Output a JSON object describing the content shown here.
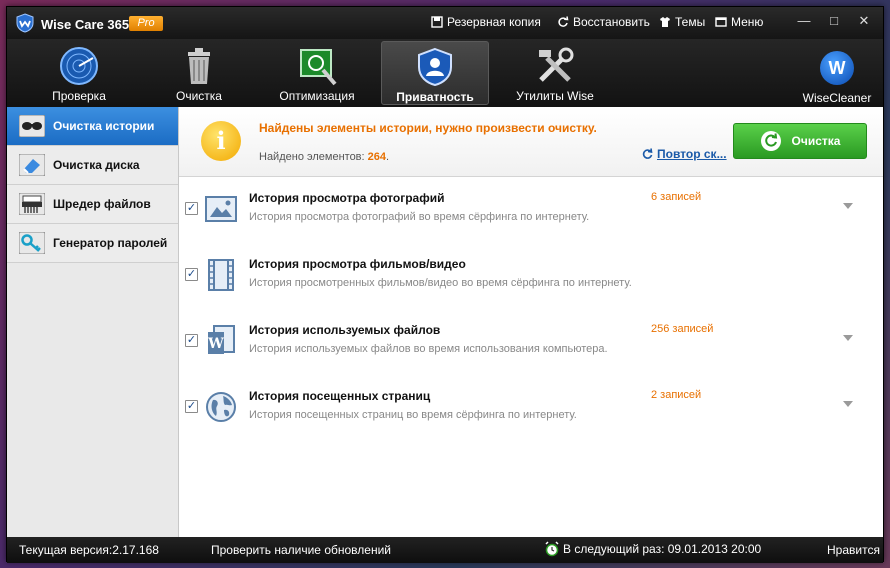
{
  "app": {
    "name": "Wise Care 365",
    "edition": "Pro"
  },
  "top_links": [
    {
      "label": "Резервная копия",
      "icon": "backup-icon"
    },
    {
      "label": "Восстановить",
      "icon": "restore-icon"
    },
    {
      "label": "Темы",
      "icon": "shirt-icon"
    },
    {
      "label": "Меню",
      "icon": "menu-icon"
    }
  ],
  "window_controls": {
    "minimize": "—",
    "maximize": "□",
    "close": "✕"
  },
  "toolbar": [
    {
      "label": "Проверка",
      "icon": "radar-icon"
    },
    {
      "label": "Очистка",
      "icon": "trash-icon"
    },
    {
      "label": "Оптимизация",
      "icon": "optimize-icon"
    },
    {
      "label": "Приватность",
      "icon": "shield-user-icon",
      "active": true
    },
    {
      "label": "Утилиты Wise",
      "icon": "tools-icon"
    }
  ],
  "brand": {
    "label": "WiseCleaner",
    "letter": "W"
  },
  "sidebar": [
    {
      "label": "Очистка истории",
      "icon": "glasses-icon",
      "active": true
    },
    {
      "label": "Очистка диска",
      "icon": "eraser-icon"
    },
    {
      "label": "Шредер файлов",
      "icon": "shredder-icon"
    },
    {
      "label": "Генератор паролей",
      "icon": "key-icon"
    }
  ],
  "banner": {
    "message": "Найдены элементы истории, нужно произвести очистку.",
    "found_label": "Найдено элементов:",
    "found_count": "264",
    "found_suffix": ".",
    "rescan_label": "Повтор ск...",
    "clean_button": "Очистка"
  },
  "items": [
    {
      "title": "История просмотра фотографий",
      "desc": "История просмотра фотографий во время сёрфинга по интернету.",
      "count": "6 записей",
      "checked": true,
      "icon": "photo-icon"
    },
    {
      "title": "История просмотра фильмов/видео",
      "desc": "История просмотренных фильмов/видео во время сёрфинга по интернету.",
      "count": "",
      "checked": true,
      "icon": "film-icon"
    },
    {
      "title": "История используемых файлов",
      "desc": "История используемых файлов во время использования компьютера.",
      "count": "256 записей",
      "checked": true,
      "icon": "word-doc-icon"
    },
    {
      "title": "История посещенных страниц",
      "desc": "История посещенных страниц во время сёрфинга по интернету.",
      "count": "2 записей",
      "checked": true,
      "icon": "globe-icon"
    }
  ],
  "status": {
    "version": "Текущая версия:2.17.168",
    "check_updates": "Проверить наличие обновлений",
    "next_run": "В следующий раз: 09.01.2013 20:00",
    "like": "Нравится"
  },
  "colors": {
    "accent_orange": "#e87000",
    "active_blue": "#1b6cc4",
    "clean_green": "#2a9a22",
    "link_blue": "#1b5aa8"
  }
}
